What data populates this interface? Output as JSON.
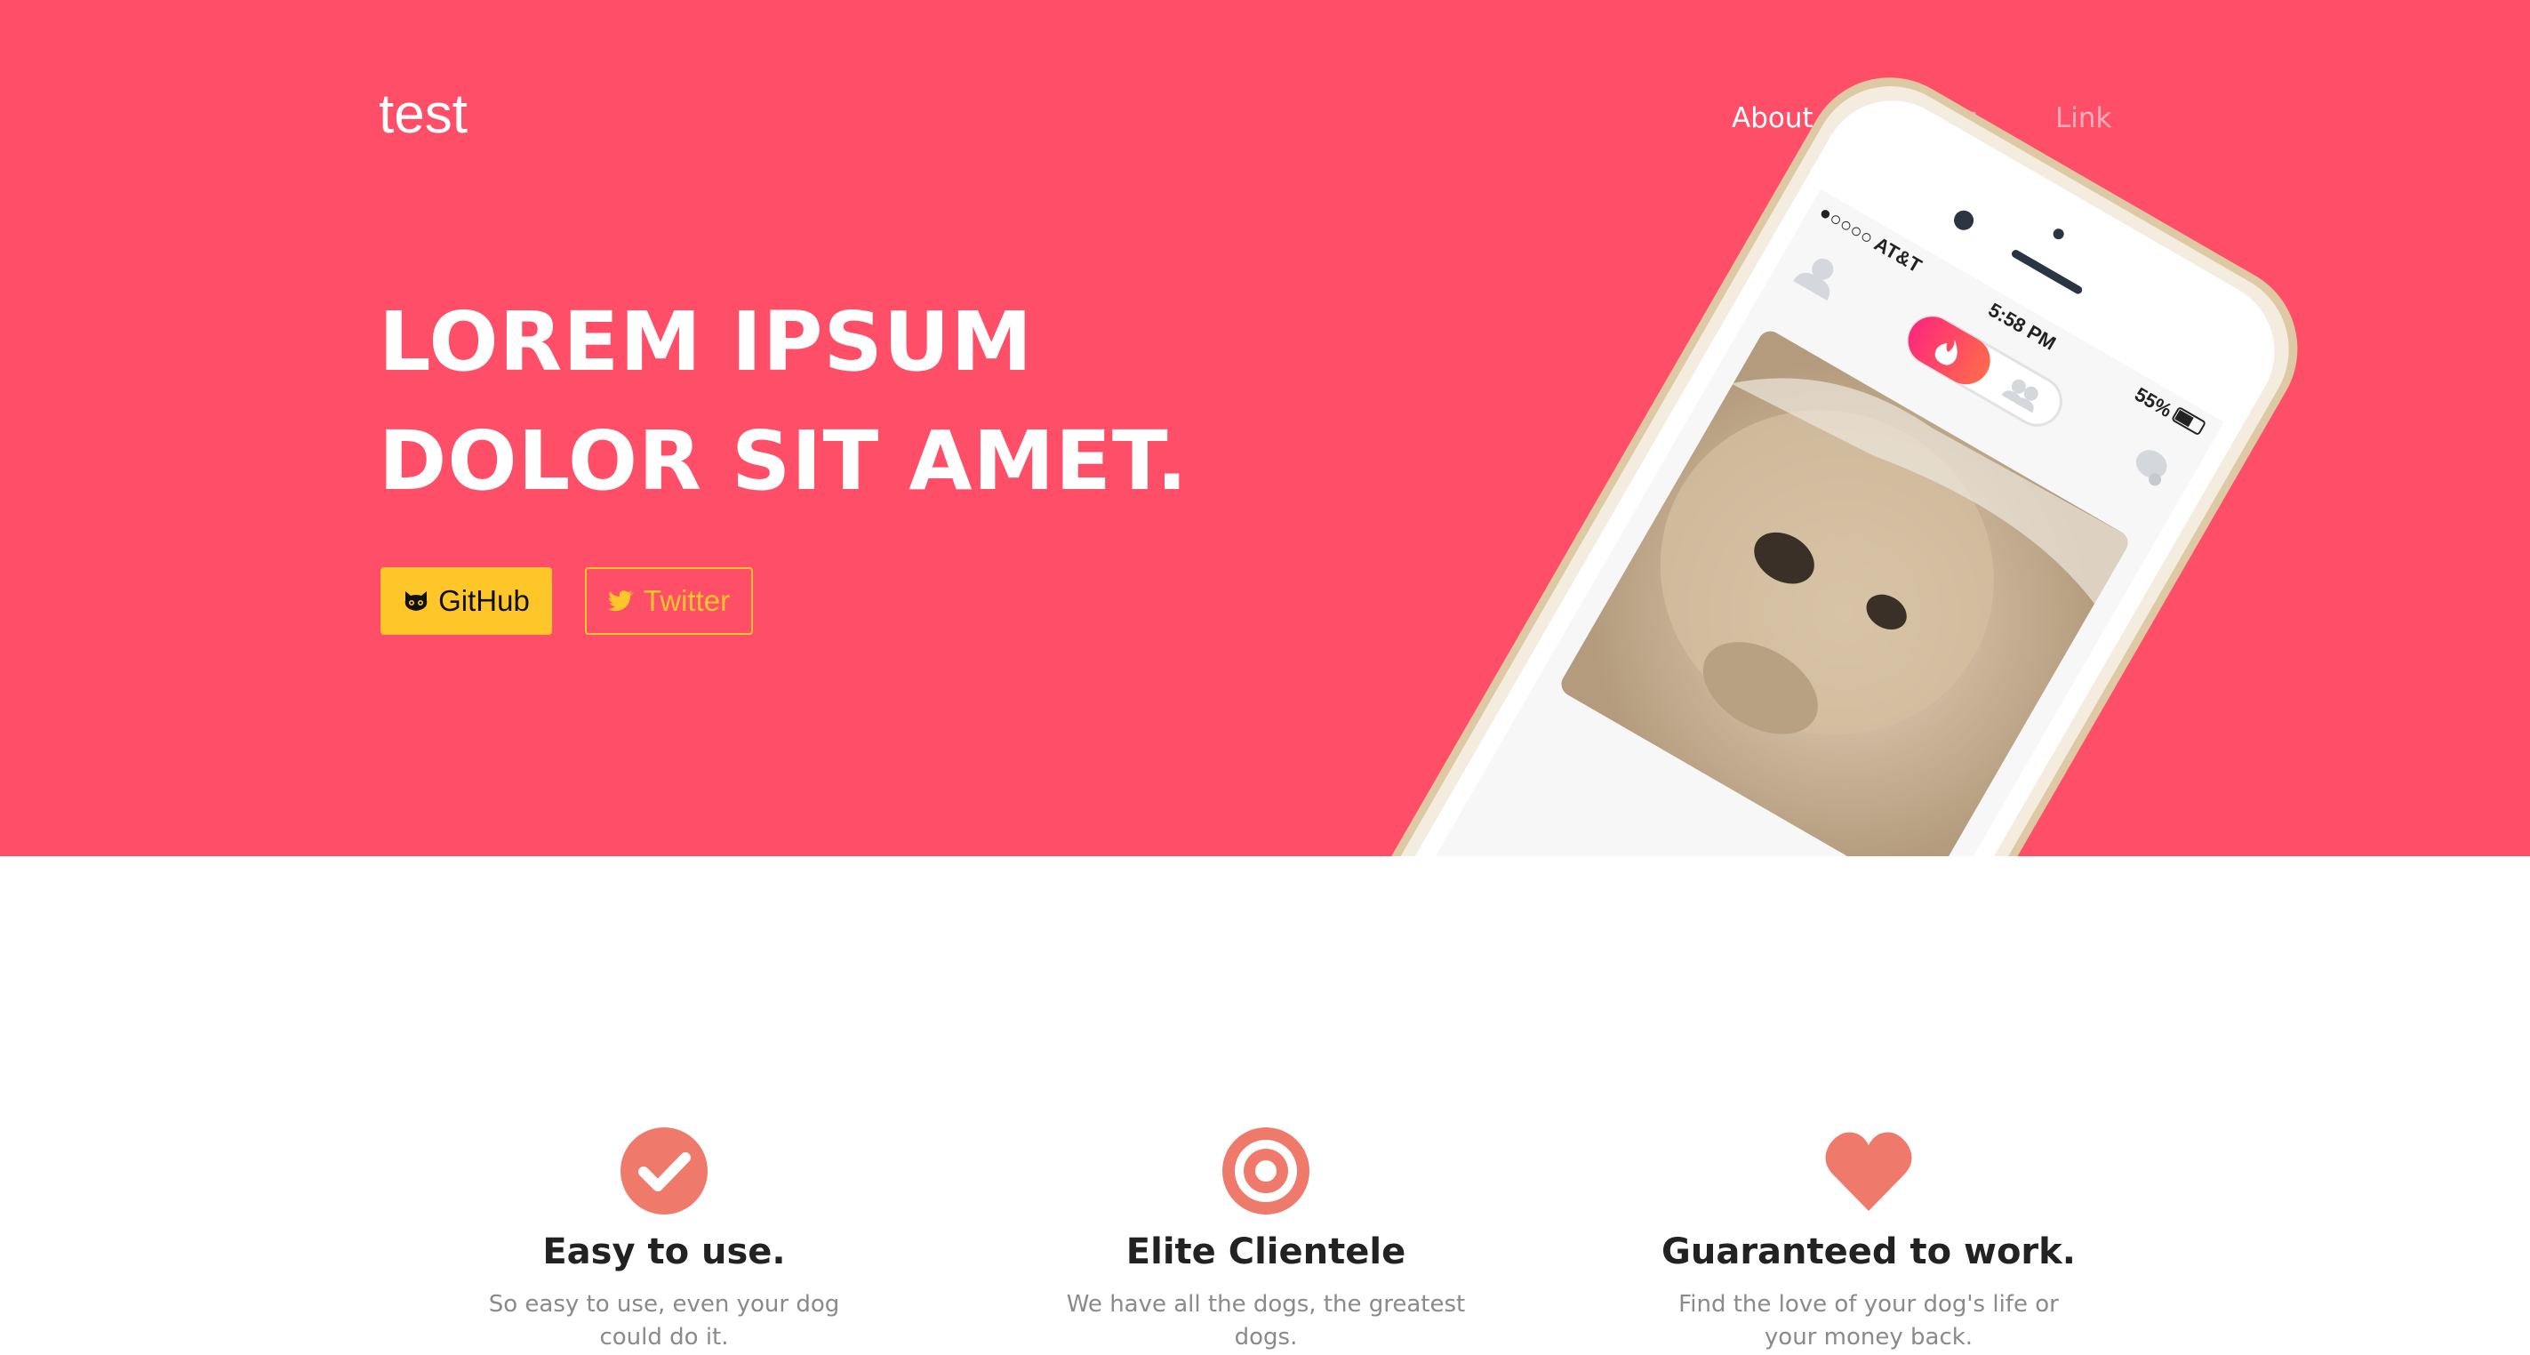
{
  "brand": "test",
  "nav": [
    {
      "label": "About",
      "active": true
    },
    {
      "label": "Prices",
      "active": false
    },
    {
      "label": "Link",
      "active": false
    }
  ],
  "hero": {
    "headline_line1": "LOREM IPSUM",
    "headline_line2": "DOLOR SIT AMET.",
    "github_label": "GitHub",
    "twitter_label": "Twitter",
    "github_icon": "github-icon",
    "twitter_icon": "twitter-icon"
  },
  "phone": {
    "carrier": "●○○○○ AT&T",
    "time": "5:58 PM",
    "battery": "55%",
    "photo_subject": "dog"
  },
  "features": [
    {
      "icon": "checkmark-circle-icon",
      "title": "Easy to use.",
      "desc": "So easy to use, even your dog could do it."
    },
    {
      "icon": "target-icon",
      "title": "Elite Clientele",
      "desc": "We have all the dogs, the greatest dogs."
    },
    {
      "icon": "heart-icon",
      "title": "Guaranteed to work.",
      "desc": "Find the love of your dog's life or your money back."
    }
  ],
  "colors": {
    "hero_bg": "#ff4f68",
    "button_yellow": "#ffc629",
    "icon_salmon": "#ef7a6c",
    "title_dark": "#222222",
    "desc_gray": "#8a8a8a"
  }
}
